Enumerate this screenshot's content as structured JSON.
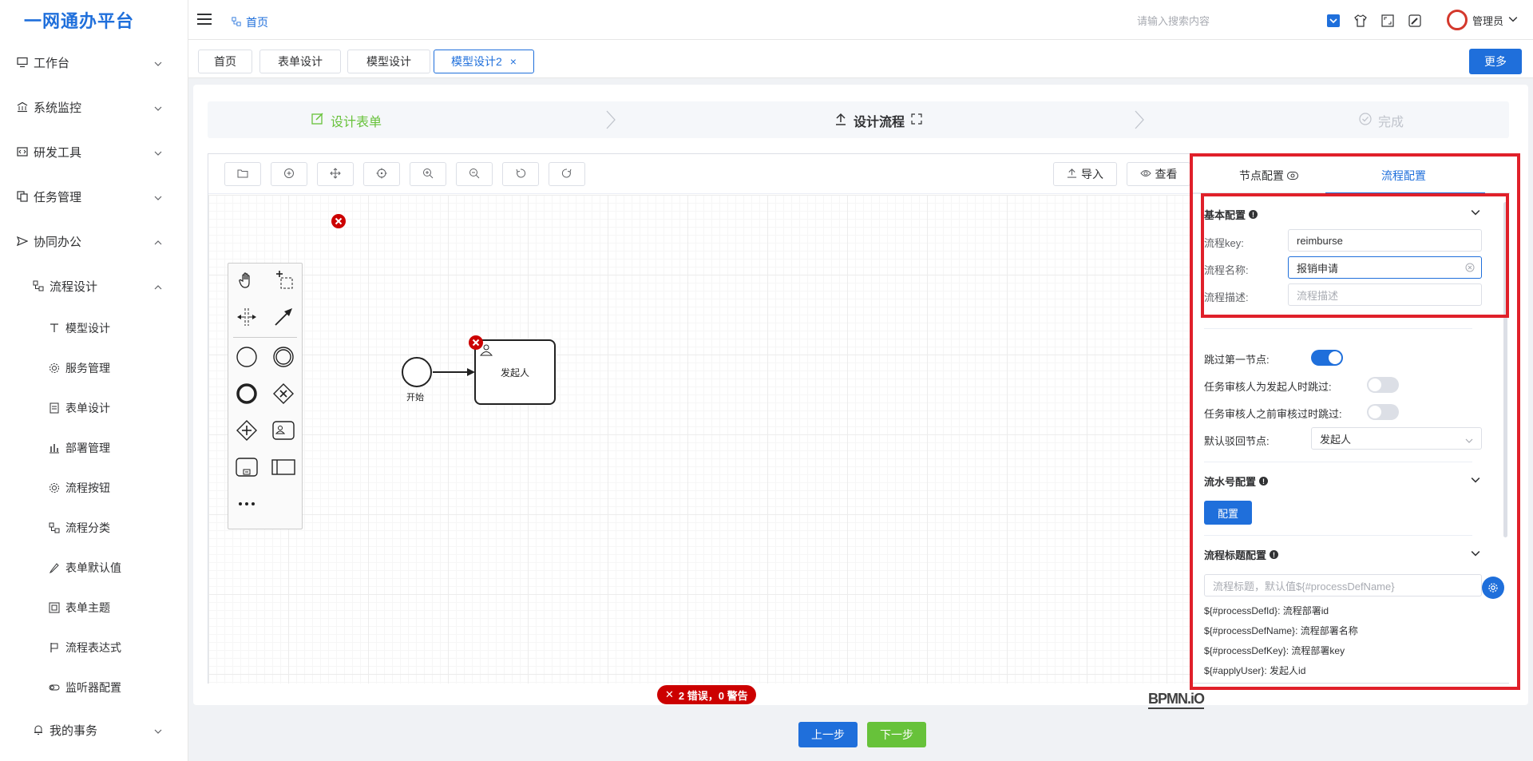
{
  "app": {
    "title": "一网通办平台"
  },
  "sidebar": {
    "items": [
      {
        "label": "工作台"
      },
      {
        "label": "系统监控"
      },
      {
        "label": "研发工具"
      },
      {
        "label": "任务管理"
      },
      {
        "label": "协同办公"
      },
      {
        "label": "流程设计"
      },
      {
        "label": "模型设计"
      },
      {
        "label": "服务管理"
      },
      {
        "label": "表单设计"
      },
      {
        "label": "部署管理"
      },
      {
        "label": "流程按钮"
      },
      {
        "label": "流程分类"
      },
      {
        "label": "表单默认值"
      },
      {
        "label": "表单主题"
      },
      {
        "label": "流程表达式"
      },
      {
        "label": "监听器配置"
      },
      {
        "label": "我的事务"
      }
    ]
  },
  "topbar": {
    "breadcrumb": "首页",
    "search_placeholder": "请输入搜索内容",
    "user": "管理员"
  },
  "tabs": [
    {
      "label": "首页"
    },
    {
      "label": "表单设计"
    },
    {
      "label": "模型设计"
    },
    {
      "label": "模型设计2",
      "close": "×"
    }
  ],
  "more_label": "更多",
  "steps": [
    {
      "label": "设计表单",
      "state": "done"
    },
    {
      "label": "设计流程",
      "state": "active"
    },
    {
      "label": "完成",
      "state": "pending"
    }
  ],
  "toolbar": {
    "import_label": "导入",
    "view_label": "查看"
  },
  "diagram": {
    "start_label": "开始",
    "task_label": "发起人",
    "error_badge": "2 错误，0 警告",
    "watermark": "BPMN.iO"
  },
  "panel": {
    "tab_node": "节点配置",
    "tab_process": "流程配置",
    "basic": {
      "title": "基本配置",
      "key_label": "流程key:",
      "key_value": "reimburse",
      "name_label": "流程名称:",
      "name_value": "报销申请",
      "desc_label": "流程描述:",
      "desc_placeholder": "流程描述"
    },
    "skip_first_label": "跳过第一节点:",
    "skip_first": true,
    "skip_initiator_label": "任务审核人为发起人时跳过:",
    "skip_initiator": false,
    "skip_prev_label": "任务审核人之前审核过时跳过:",
    "skip_prev": false,
    "reject_label": "默认驳回节点:",
    "reject_value": "发起人",
    "serial_title": "流水号配置",
    "serial_button": "配置",
    "title_cfg_title": "流程标题配置",
    "title_placeholder": "流程标题，默认值${#processDefName}",
    "vars": [
      {
        "code": "${#processDefId}",
        "desc": ": 流程部署id"
      },
      {
        "code": "${#processDefName}",
        "desc": ": 流程部署名称"
      },
      {
        "code": "${#processDefKey}",
        "desc": ": 流程部署key"
      },
      {
        "code": "${#applyUser}",
        "desc": ": 发起人id"
      }
    ]
  },
  "bottom": {
    "prev": "上一步",
    "next": "下一步"
  },
  "colors": {
    "primary": "#1f6fdb",
    "success": "#67c23a",
    "error": "#cc0000",
    "highlight": "#e0202a"
  }
}
